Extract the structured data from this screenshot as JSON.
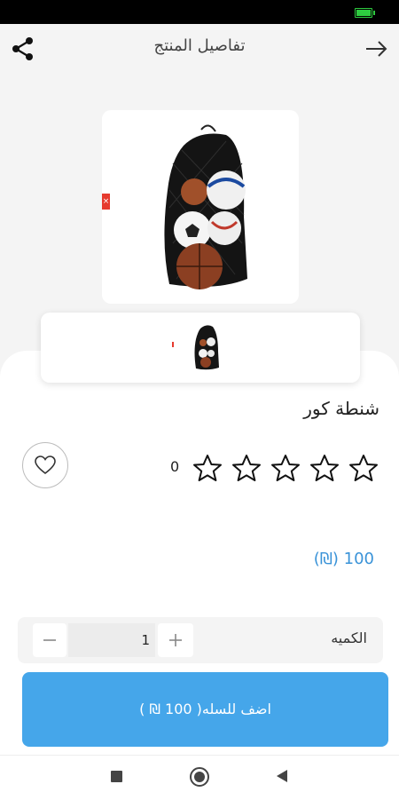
{
  "header": {
    "title": "تفاصيل المنتج"
  },
  "product": {
    "name": "شنطة كور",
    "rating_count": "0",
    "rating_value": 0,
    "rating_max": 5,
    "price": "100 (₪)"
  },
  "quantity": {
    "label": "الكميه",
    "value": "1",
    "minus": "—",
    "plus": "+"
  },
  "cart_button": {
    "label": "اضف للسله( 100 ₪ )"
  },
  "colors": {
    "accent": "#45a6ea",
    "price": "#3a93d8",
    "tag": "#e63a2e"
  },
  "icons": {
    "share": "share-icon",
    "back": "arrow-right-icon",
    "favorite": "heart-icon",
    "star": "star-outline-icon"
  }
}
